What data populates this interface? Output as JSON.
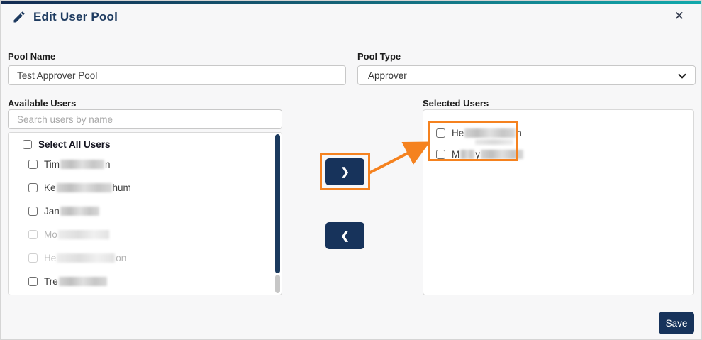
{
  "colors": {
    "navy": "#17335B",
    "orange": "#F5821F",
    "gradient_start": "#132B52",
    "gradient_end": "#11A9AC"
  },
  "header": {
    "title": "Edit User Pool",
    "close_glyph": "✕"
  },
  "fields": {
    "pool_name": {
      "label": "Pool Name",
      "value": "Test Approver Pool"
    },
    "pool_type": {
      "label": "Pool Type",
      "value": "Approver"
    }
  },
  "available": {
    "label": "Available Users",
    "search_placeholder": "Search users by name",
    "select_all_label": "Select All Users",
    "users": [
      {
        "prefix": "Tim",
        "mid": "",
        "suffix": "n",
        "redact1": 62,
        "redact2": 0,
        "disabled": false,
        "underblur": 0
      },
      {
        "prefix": "Ke",
        "mid": "",
        "suffix": "hum",
        "redact1": 78,
        "redact2": 0,
        "disabled": false,
        "underblur": 0
      },
      {
        "prefix": "Jan",
        "mid": "",
        "suffix": "",
        "redact1": 55,
        "redact2": 0,
        "disabled": false,
        "underblur": 0
      },
      {
        "prefix": "Mo",
        "mid": "",
        "suffix": "",
        "redact1": 72,
        "redact2": 0,
        "disabled": true,
        "underblur": 0
      },
      {
        "prefix": "He",
        "mid": "",
        "suffix": "on",
        "redact1": 82,
        "redact2": 0,
        "disabled": true,
        "underblur": 0
      },
      {
        "prefix": "Tre",
        "mid": "",
        "suffix": "",
        "redact1": 68,
        "redact2": 0,
        "disabled": false,
        "underblur": 0
      }
    ]
  },
  "selected": {
    "label": "Selected Users",
    "users": [
      {
        "prefix": "He",
        "mid": "",
        "suffix": "n",
        "redact1": 72,
        "redact2": 0,
        "disabled": false,
        "underblur": 54
      },
      {
        "prefix": "M",
        "mid": "y",
        "suffix": "",
        "redact1": 20,
        "redact2": 60,
        "disabled": false,
        "underblur": 0
      }
    ]
  },
  "transfer": {
    "move_right_glyph": "❯",
    "move_left_glyph": "❮"
  },
  "footer": {
    "save_label": "Save"
  }
}
